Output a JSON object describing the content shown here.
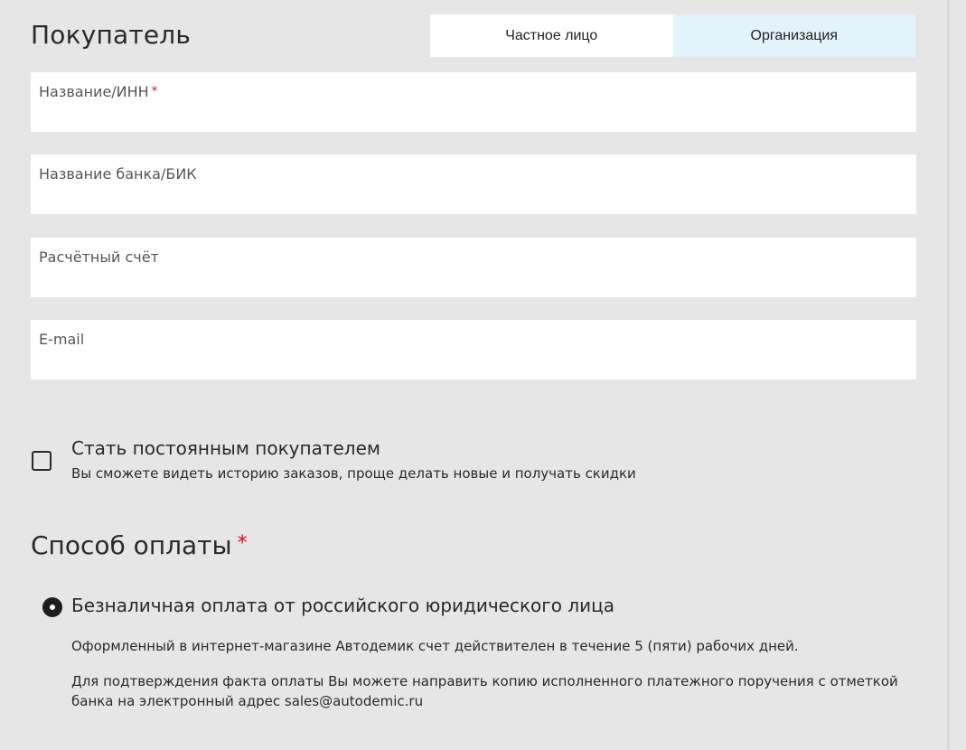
{
  "buyer": {
    "title": "Покупатель",
    "type_tabs": [
      {
        "label": "Частное лицо",
        "selected": false
      },
      {
        "label": "Организация",
        "selected": true
      }
    ]
  },
  "fields": [
    {
      "label": "Название/ИНН",
      "required_mark": "*",
      "value": ""
    },
    {
      "label": "Название банка/БИК",
      "value": ""
    },
    {
      "label": "Расчётный счёт",
      "value": ""
    },
    {
      "label": "E-mail",
      "value": ""
    }
  ],
  "loyalty": {
    "checked": false,
    "title": "Стать постоянным покупателем",
    "description": "Вы сможете видеть историю заказов, проще делать новые и получать скидки"
  },
  "payment": {
    "title": "Способ оплаты",
    "required_mark": "*",
    "option": {
      "label": "Безналичная оплата от российского юридического лица",
      "selected": true
    },
    "notes": [
      "Оформленный в интернет-магазине Автодемик счет действителен в течение 5 (пяти) рабочих дней.",
      "Для подтверждения факта оплаты Вы можете направить копию исполненного платежного поручения с отметкой банка на электронный адрес sales@autodemic.ru"
    ]
  },
  "colors": {
    "background": "#e6e6e6",
    "field_background": "#ffffff",
    "selected_tab": "#e3f3fb",
    "required": "#e30613",
    "text": "#2a2a2a"
  }
}
